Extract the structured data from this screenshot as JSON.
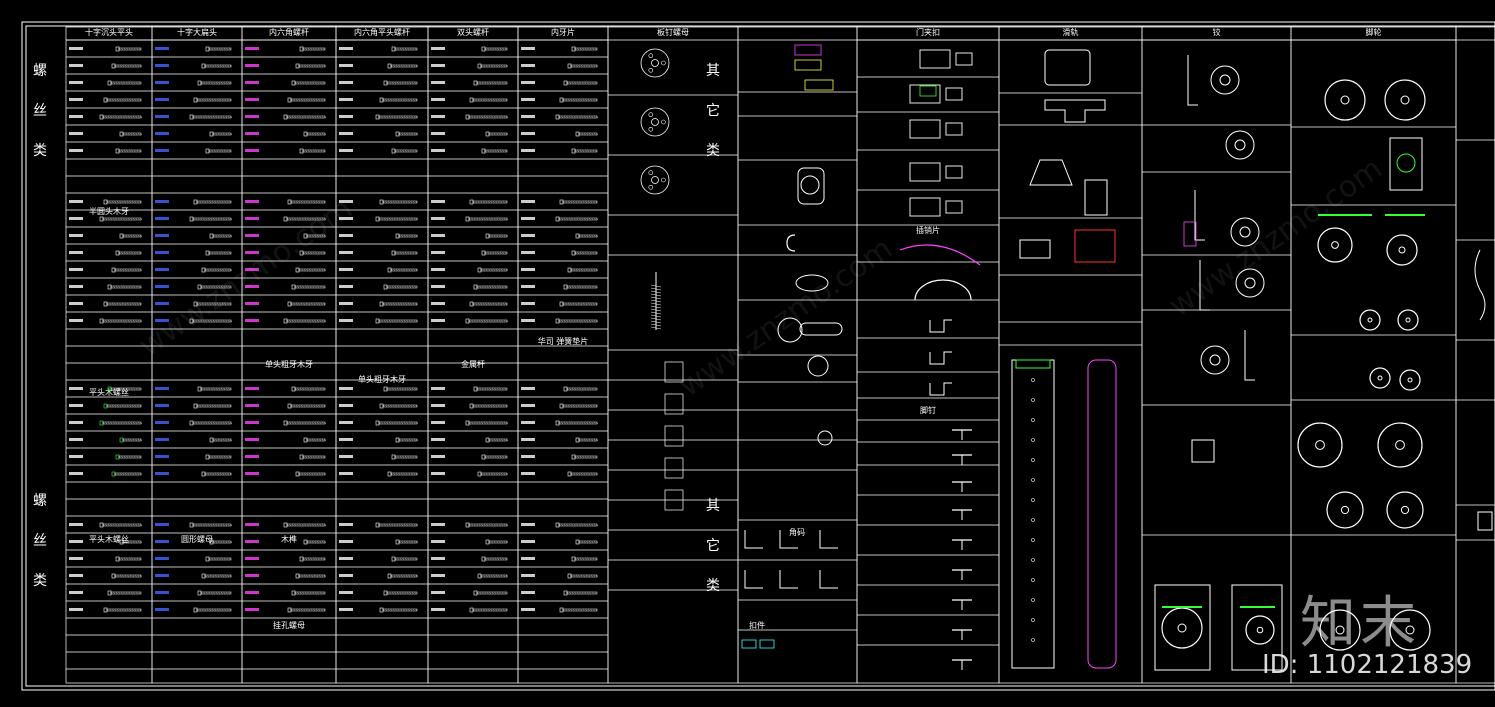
{
  "sheet": {
    "side_label_top": [
      "螺",
      "丝",
      "类"
    ],
    "side_label_bottom": [
      "螺",
      "丝",
      "类"
    ],
    "headers": [
      "十字沉头平头",
      "十字大扁头",
      "内六角螺杆",
      "内六角平头螺杆",
      "双头螺杆",
      "内牙片",
      "板钉螺母",
      "",
      "门夹扣",
      "滑轨",
      "铰",
      "脚轮"
    ],
    "sub_headers": {
      "col1_mid": "半圆头木牙",
      "col1_low": "平头木螺丝",
      "col1_bottom": "平头木螺丝",
      "col2_bottom": "圆形螺母",
      "col3_mid": "单头粗牙木牙",
      "col3_bottom": "木榫",
      "col3_bottom2": "挂孔螺母",
      "col4_mid": "单头粗牙木牙",
      "col5_mid": "金属杆",
      "col6_mid": "华司 弹簧垫片",
      "col9_mid": "插销片",
      "col9_mid2": "脚钉",
      "col8_mid": "角码",
      "col8_bottom": "扣件"
    },
    "other_label_top": [
      "其",
      "它",
      "类"
    ],
    "other_label_bottom": [
      "其",
      "它",
      "类"
    ]
  },
  "watermark": {
    "logo": "知末",
    "id_text": "ID: 1102121839",
    "diagonal": "www.znzmo.com"
  },
  "colors": {
    "background": "#000000",
    "line": "#ffffff",
    "accent_magenta": "#ff44ff",
    "accent_green": "#33ff33",
    "accent_blue": "#4466ff",
    "accent_red": "#ff3333",
    "accent_cyan": "#33ffff",
    "accent_yellow": "#ffff44"
  }
}
